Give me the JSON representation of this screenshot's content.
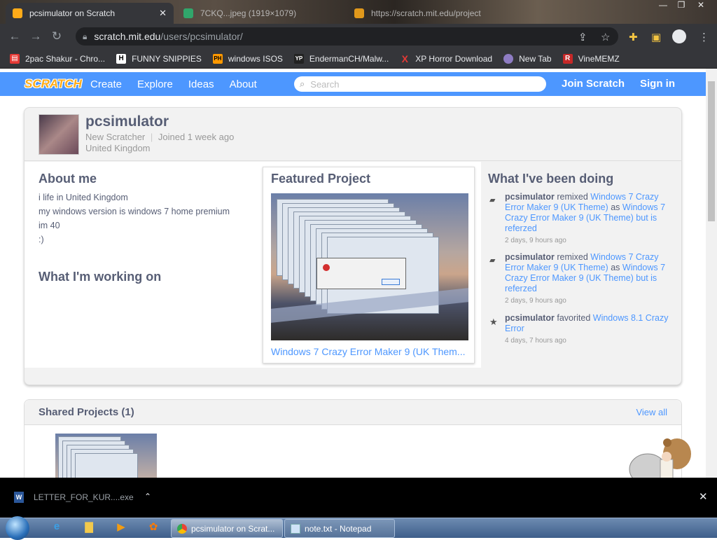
{
  "browser": {
    "tabs": [
      {
        "title": "pcsimulator on Scratch",
        "active": true
      },
      {
        "title": "7CKQ...jpeg (1919×1079)",
        "active": false
      },
      {
        "title": "https://scratch.mit.edu/project",
        "active": false
      }
    ],
    "url_host": "scratch.mit.edu",
    "url_path": "/users/pcsimulator/",
    "bookmarks": [
      {
        "label": "2pac Shakur - Chro...",
        "icon": "chrome-web-store-icon",
        "color": "#e0e0e0"
      },
      {
        "label": "FUNNY SNIPPIES",
        "icon": "h-icon",
        "color": "#ffffff"
      },
      {
        "label": "windows ISOS",
        "icon": "ph-icon",
        "color": "#ff9900"
      },
      {
        "label": "EndermanCH/Malw...",
        "icon": "yp-icon",
        "color": "#333333"
      },
      {
        "label": "XP Horror Download",
        "icon": "x-icon",
        "color": "#d32f2f"
      },
      {
        "label": "New Tab",
        "icon": "globe-icon",
        "color": "#8e7cc3"
      },
      {
        "label": "VineMEMZ",
        "icon": "r-icon",
        "color": "#c62828"
      }
    ]
  },
  "scratch_nav": {
    "logo": "SCRATCH",
    "links": [
      "Create",
      "Explore",
      "Ideas",
      "About"
    ],
    "search_placeholder": "Search",
    "join": "Join Scratch",
    "signin": "Sign in"
  },
  "profile": {
    "username": "pcsimulator",
    "status": "New Scratcher",
    "joined": "Joined 1 week ago",
    "location": "United Kingdom",
    "about_title": "About me",
    "about_lines": [
      "i life in United Kingdom",
      "my windows version is windows 7 home premium",
      "im 40",
      ":)"
    ],
    "working_title": "What I'm working on",
    "featured_title": "Featured Project",
    "featured_project": "Windows 7 Crazy Error Maker 9 (UK Them...",
    "activity_title": "What I've been doing",
    "activity": [
      {
        "icon": "remix-icon",
        "user": "pcsimulator",
        "verb": "remixed",
        "target": "Windows 7 Crazy Error Maker 9 (UK Theme)",
        "as": "as",
        "result": "Windows 7 Crazy Error Maker 9 (UK Theme) but is referzed",
        "when": "2 days, 9 hours ago"
      },
      {
        "icon": "remix-icon",
        "user": "pcsimulator",
        "verb": "remixed",
        "target": "Windows 7 Crazy Error Maker 9 (UK Theme)",
        "as": "as",
        "result": "Windows 7 Crazy Error Maker 9 (UK Theme) but is referzed",
        "when": "2 days, 9 hours ago"
      },
      {
        "icon": "star-icon",
        "user": "pcsimulator",
        "verb": "favorited",
        "target": "Windows 8.1 Crazy Error",
        "as": "",
        "result": "",
        "when": "4 days, 7 hours ago"
      }
    ]
  },
  "shared": {
    "title": "Shared Projects (1)",
    "view_all": "View all"
  },
  "download_bar": {
    "file": "LETTER_FOR_KUR....exe"
  },
  "taskbar": {
    "tasks": [
      {
        "label": "pcsimulator on Scrat...",
        "icon": "chrome-icon"
      },
      {
        "label": "note.txt - Notepad",
        "icon": "notepad-icon"
      }
    ]
  },
  "colors": {
    "scratch_blue": "#4d97ff",
    "scratch_text": "#575e75",
    "chrome_dark": "#35363a"
  }
}
